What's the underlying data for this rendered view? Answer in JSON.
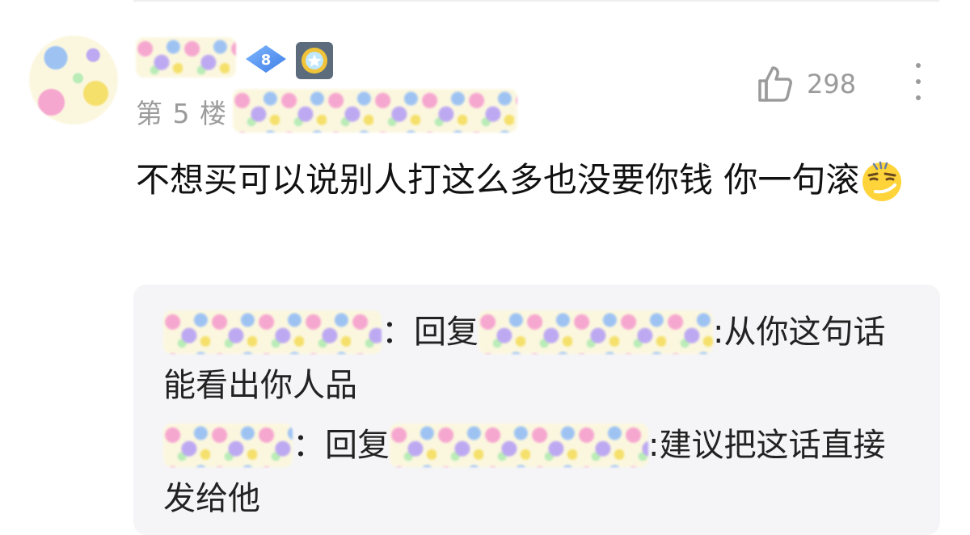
{
  "comment": {
    "level": "8",
    "floor_label": "第 5 楼",
    "like_count": "298",
    "text": "不想买可以说别人打这么多也没要你钱 你一句滚",
    "emoji_icon": "smug-face-emoji"
  },
  "replies": [
    {
      "separator": "：",
      "reply_word": "回复",
      "content": ":从你这句话能看出你人品"
    },
    {
      "separator": "：",
      "reply_word": "回复",
      "content": ":建议把这话直接发给他"
    }
  ],
  "colors": {
    "meta_gray": "#9b9b9b",
    "text_dark": "#111111",
    "reply_bg": "#f5f5f7",
    "level_badge": "#4f8ff0"
  }
}
